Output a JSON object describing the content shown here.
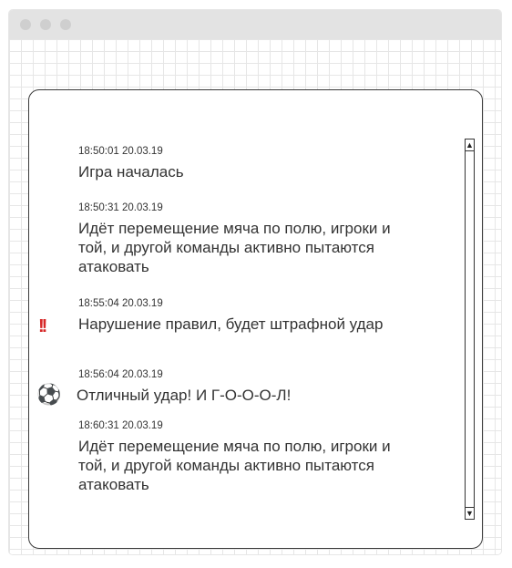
{
  "window": {
    "controls": [
      "close",
      "minimize",
      "maximize"
    ]
  },
  "feed": {
    "entries": [
      {
        "time": "18:50:01 20.03.19",
        "text": "Игра началась",
        "icon": null
      },
      {
        "time": "18:50:31 20.03.19",
        "text": "Идёт перемещение мяча по полю, игроки и той, и другой команды активно пытаются атаковать",
        "icon": null
      },
      {
        "time": "18:55:04 20.03.19",
        "text": "Нарушение правил, будет штрафной удар",
        "icon": "double-exclamation-icon"
      },
      {
        "time": "18:56:04 20.03.19",
        "text": "Отличный удар! И Г-О-О-О-Л!",
        "icon": "soccer-ball-icon"
      },
      {
        "time": "18:60:31 20.03.19",
        "text": "Идёт перемещение мяча по полю, игроки и той, и другой команды активно пытаются атаковать",
        "icon": null
      }
    ]
  },
  "scrollbar": {
    "up_icon": "triangle-up-icon",
    "down_icon": "triangle-down-icon"
  },
  "colors": {
    "text": "#333333",
    "alert": "#d62828",
    "border": "#3a3a3a",
    "grid": "#e6e6e6",
    "titlebar": "#e3e3e3"
  }
}
